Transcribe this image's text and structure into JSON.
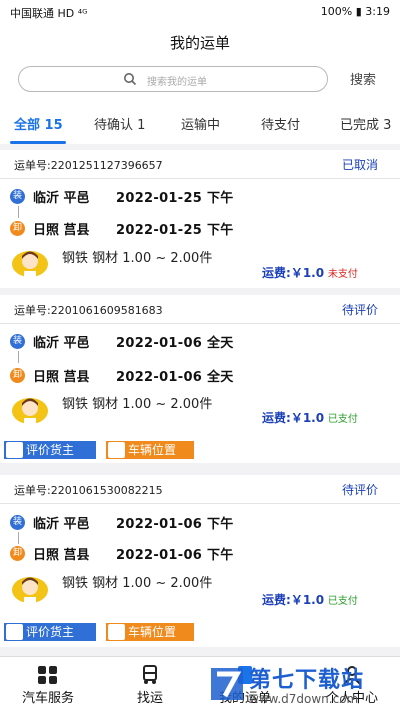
{
  "status_bar": {
    "carrier": "中国联通 HD ⁴ᴳ",
    "battery": "100%",
    "time": "3:19"
  },
  "header": {
    "title": "我的运单"
  },
  "search": {
    "placeholder": "搜索我的运单",
    "button_label": "搜索"
  },
  "tabs": [
    {
      "label": "全部 15",
      "active": true
    },
    {
      "label": "待确认 1",
      "active": false
    },
    {
      "label": "运输中",
      "active": false
    },
    {
      "label": "待支付",
      "active": false
    },
    {
      "label": "已完成 3",
      "active": false
    }
  ],
  "orders": [
    {
      "order_no": "运单号:2201251127396657",
      "status": "已取消",
      "load_badge": "装",
      "unload_badge": "卸",
      "from_place": "临沂 平邑",
      "from_date": "2022-01-25 下午",
      "to_place": "日照 莒县",
      "to_date": "2022-01-25 下午",
      "cargo": "钢铁  钢材 1.00 ~ 2.00件",
      "fee_label": "运费:",
      "fee_amount": "￥1.0",
      "pay_status": "未支付",
      "paid": false
    },
    {
      "order_no": "运单号:2201061609581683",
      "status": "待评价",
      "load_badge": "装",
      "unload_badge": "卸",
      "from_place": "临沂 平邑",
      "from_date": "2022-01-06 全天",
      "to_place": "日照 莒县",
      "to_date": "2022-01-06 全天",
      "cargo": "钢铁  钢材 1.00 ~ 2.00件",
      "fee_label": "运费:",
      "fee_amount": "￥1.0",
      "pay_status": "已支付",
      "paid": true,
      "actions": [
        "评价货主",
        "车辆位置"
      ]
    },
    {
      "order_no": "运单号:2201061530082215",
      "status": "待评价",
      "load_badge": "装",
      "unload_badge": "卸",
      "from_place": "临沂 平邑",
      "from_date": "2022-01-06 下午",
      "to_place": "日照 莒县",
      "to_date": "2022-01-06 下午",
      "cargo": "钢铁  钢材 1.00 ~ 2.00件",
      "fee_label": "运费:",
      "fee_amount": "￥1.0",
      "pay_status": "已支付",
      "paid": true,
      "actions": [
        "评价货主",
        "车辆位置"
      ]
    }
  ],
  "bottom_nav": [
    {
      "label": "汽车服务",
      "icon": "grid-icon"
    },
    {
      "label": "找运",
      "icon": "truck-icon"
    },
    {
      "label": "我的运单",
      "icon": "waybill-icon"
    },
    {
      "label": "个人中心",
      "icon": "person-icon"
    }
  ],
  "watermark": {
    "text": "第七下载站",
    "url": "www.d7down.com"
  },
  "colors": {
    "accent": "#1a73e8",
    "status_blue": "#1a3fb8",
    "unpaid": "#d9251d",
    "paid": "#2a9d2a",
    "load_badge": "#2f6fd6",
    "unload_badge": "#f08a1c"
  }
}
